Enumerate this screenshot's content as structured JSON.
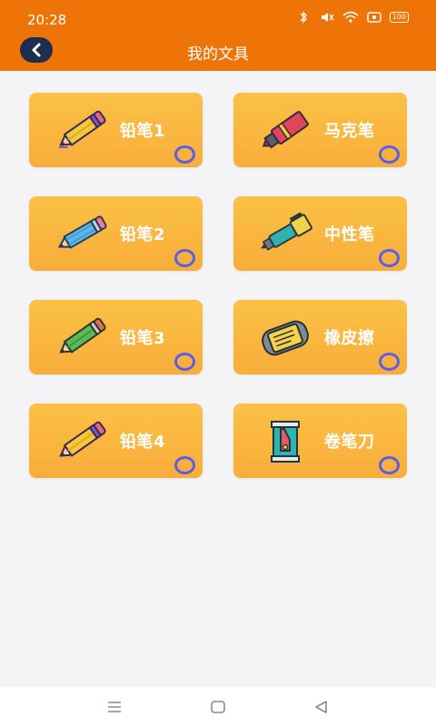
{
  "status": {
    "time": "20:28",
    "battery": "100"
  },
  "header": {
    "title": "我的文具"
  },
  "items": [
    {
      "label": "铅笔1",
      "icon": "pencil-purple-icon"
    },
    {
      "label": "马克笔",
      "icon": "marker-icon"
    },
    {
      "label": "铅笔2",
      "icon": "pencil-blue-icon"
    },
    {
      "label": "中性笔",
      "icon": "gel-pen-icon"
    },
    {
      "label": "铅笔3",
      "icon": "pencil-green-icon"
    },
    {
      "label": "橡皮擦",
      "icon": "eraser-icon"
    },
    {
      "label": "铅笔4",
      "icon": "pencil-purple-icon"
    },
    {
      "label": "卷笔刀",
      "icon": "sharpener-icon"
    }
  ],
  "colors": {
    "accent": "#ee7407",
    "card": "#fbb941",
    "radio": "#5b5ee6"
  }
}
